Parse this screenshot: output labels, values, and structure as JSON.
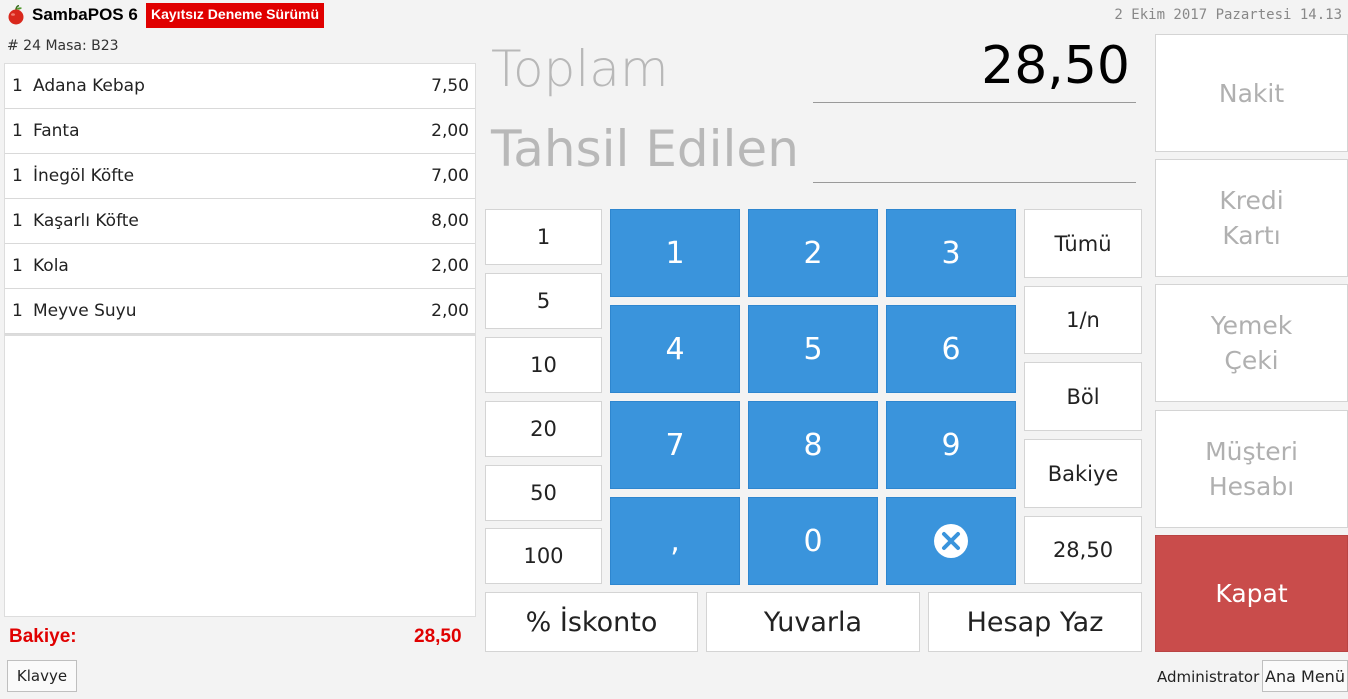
{
  "header": {
    "app_name": "SambaPOS 6",
    "trial_badge": "Kayıtsız Deneme Sürümü",
    "datetime": "2 Ekim 2017 Pazartesi 14.13"
  },
  "ticket": {
    "header": "# 24 Masa: B23",
    "orders": [
      {
        "qty": "1",
        "name": "Adana Kebap",
        "price": "7,50"
      },
      {
        "qty": "1",
        "name": "Fanta",
        "price": "2,00"
      },
      {
        "qty": "1",
        "name": "İnegöl Köfte",
        "price": "7,00"
      },
      {
        "qty": "1",
        "name": "Kaşarlı Köfte",
        "price": "8,00"
      },
      {
        "qty": "1",
        "name": "Kola",
        "price": "2,00"
      },
      {
        "qty": "1",
        "name": "Meyve Suyu",
        "price": "2,00"
      }
    ],
    "balance_label": "Bakiye:",
    "balance_value": "28,50"
  },
  "keyboard_label": "Klavye",
  "payment": {
    "total_label": "Toplam",
    "total_value": "28,50",
    "tendered_label": "Tahsil Edilen",
    "tendered_value": ""
  },
  "amount_buttons": [
    "1",
    "5",
    "10",
    "20",
    "50",
    "100"
  ],
  "numpad": [
    "1",
    "2",
    "3",
    "4",
    "5",
    "6",
    "7",
    "8",
    "9",
    ",",
    "0"
  ],
  "numpad_clear_icon": "circle-x-icon",
  "split_buttons": [
    "Tümü",
    "1/n",
    "Böl",
    "Bakiye",
    "28,50"
  ],
  "bottom_buttons": {
    "discount": "% İskonto",
    "round": "Yuvarla",
    "print_bill": "Hesap Yaz"
  },
  "payment_types": {
    "cash": [
      "Nakit"
    ],
    "credit_card": [
      "Kredi",
      "Kartı"
    ],
    "meal_voucher": [
      "Yemek",
      "Çeki"
    ],
    "customer_account": [
      "Müşteri",
      "Hesabı"
    ]
  },
  "close_label": "Kapat",
  "user": "Administrator",
  "main_menu_label": "Ana Menü",
  "colors": {
    "accent_blue": "#3a94dc",
    "close_red": "#c94c4b",
    "alert_red": "#e00000"
  }
}
